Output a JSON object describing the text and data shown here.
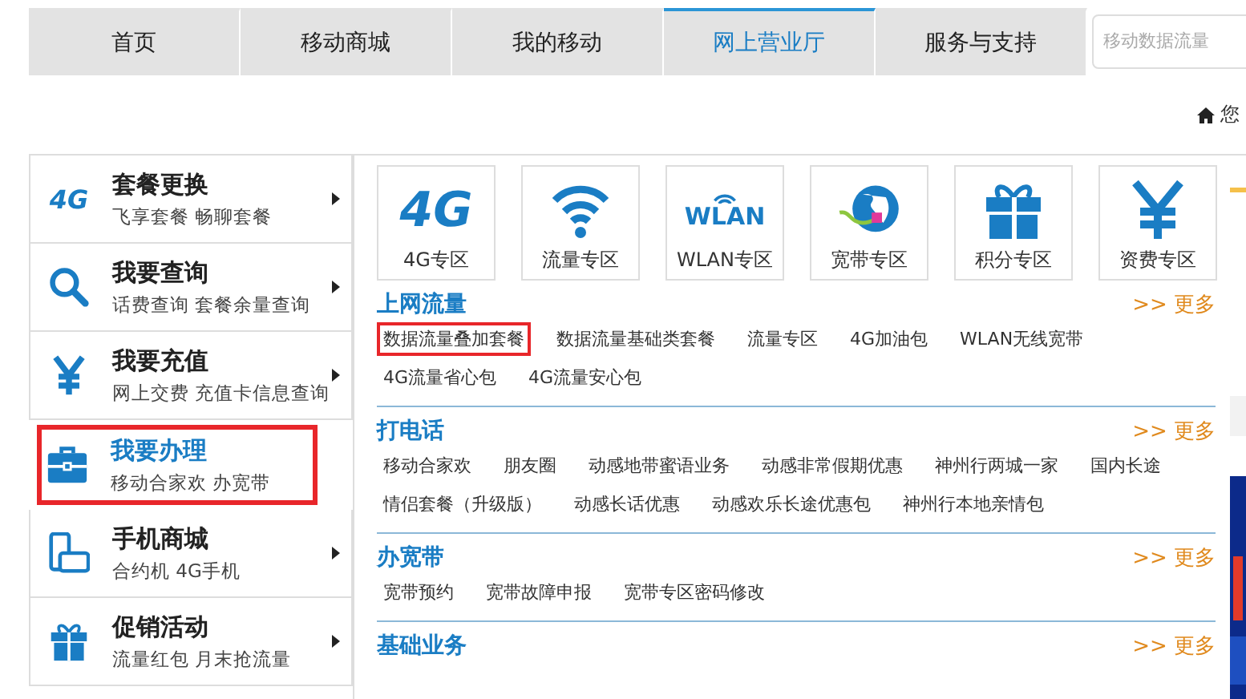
{
  "nav": {
    "tabs": [
      {
        "label": "首页",
        "selected": false
      },
      {
        "label": "移动商城",
        "selected": false
      },
      {
        "label": "我的移动",
        "selected": false
      },
      {
        "label": "网上营业厅",
        "selected": true
      },
      {
        "label": "服务与支持",
        "selected": false
      }
    ],
    "search": {
      "placeholder": "移动数据流量"
    }
  },
  "breadcrumb": {
    "text": "您"
  },
  "sidebar": {
    "items": [
      {
        "kind": "logo",
        "logo_text": "4G",
        "title": "套餐更换",
        "sub": "飞享套餐 畅聊套餐",
        "selected": false
      },
      {
        "kind": "search",
        "title": "我要查询",
        "sub": "话费查询 套餐余量查询",
        "selected": false
      },
      {
        "kind": "yen",
        "title": "我要充值",
        "sub": "网上交费 充值卡信息查询",
        "selected": false
      },
      {
        "kind": "briefcase",
        "title": "我要办理",
        "sub": "移动合家欢 办宽带",
        "selected": true
      },
      {
        "kind": "phone",
        "title": "手机商城",
        "sub": "合约机 4G手机",
        "selected": false
      },
      {
        "kind": "gift",
        "title": "促销活动",
        "sub": "流量红包 月末抢流量",
        "selected": false
      }
    ]
  },
  "tiles": [
    {
      "kind": "logo",
      "logo_text": "4G",
      "label": "4G专区"
    },
    {
      "kind": "wifi",
      "label": "流量专区"
    },
    {
      "kind": "wlan",
      "logo_text": "WLAN",
      "label": "WLAN专区"
    },
    {
      "kind": "globe",
      "label": "宽带专区"
    },
    {
      "kind": "gift",
      "label": "积分专区"
    },
    {
      "kind": "yen",
      "label": "资费专区"
    }
  ],
  "sections": [
    {
      "title": "上网流量",
      "more": ">> 更多",
      "links": [
        {
          "text": "数据流量叠加套餐",
          "highlighted": true
        },
        {
          "text": "数据流量基础类套餐",
          "highlighted": false
        },
        {
          "text": "流量专区",
          "highlighted": false
        },
        {
          "text": "4G加油包",
          "highlighted": false
        },
        {
          "text": "WLAN无线宽带",
          "highlighted": false
        },
        {
          "text": "4G流量省心包",
          "highlighted": false
        },
        {
          "text": "4G流量安心包",
          "highlighted": false
        }
      ]
    },
    {
      "title": "打电话",
      "more": ">> 更多",
      "links": [
        {
          "text": "移动合家欢",
          "highlighted": false
        },
        {
          "text": "朋友圈",
          "highlighted": false
        },
        {
          "text": "动感地带蜜语业务",
          "highlighted": false
        },
        {
          "text": "动感非常假期优惠",
          "highlighted": false
        },
        {
          "text": "神州行两城一家",
          "highlighted": false
        },
        {
          "text": "国内长途",
          "highlighted": false
        },
        {
          "text": "情侣套餐（升级版）",
          "highlighted": false
        },
        {
          "text": "动感长话优惠",
          "highlighted": false
        },
        {
          "text": "动感欢乐长途优惠包",
          "highlighted": false
        },
        {
          "text": "神州行本地亲情包",
          "highlighted": false
        }
      ]
    },
    {
      "title": "办宽带",
      "more": ">> 更多",
      "links": [
        {
          "text": "宽带预约",
          "highlighted": false
        },
        {
          "text": "宽带故障申报",
          "highlighted": false
        },
        {
          "text": "宽带专区密码修改",
          "highlighted": false
        }
      ]
    },
    {
      "title": "基础业务",
      "more": ">> 更多"
    }
  ]
}
